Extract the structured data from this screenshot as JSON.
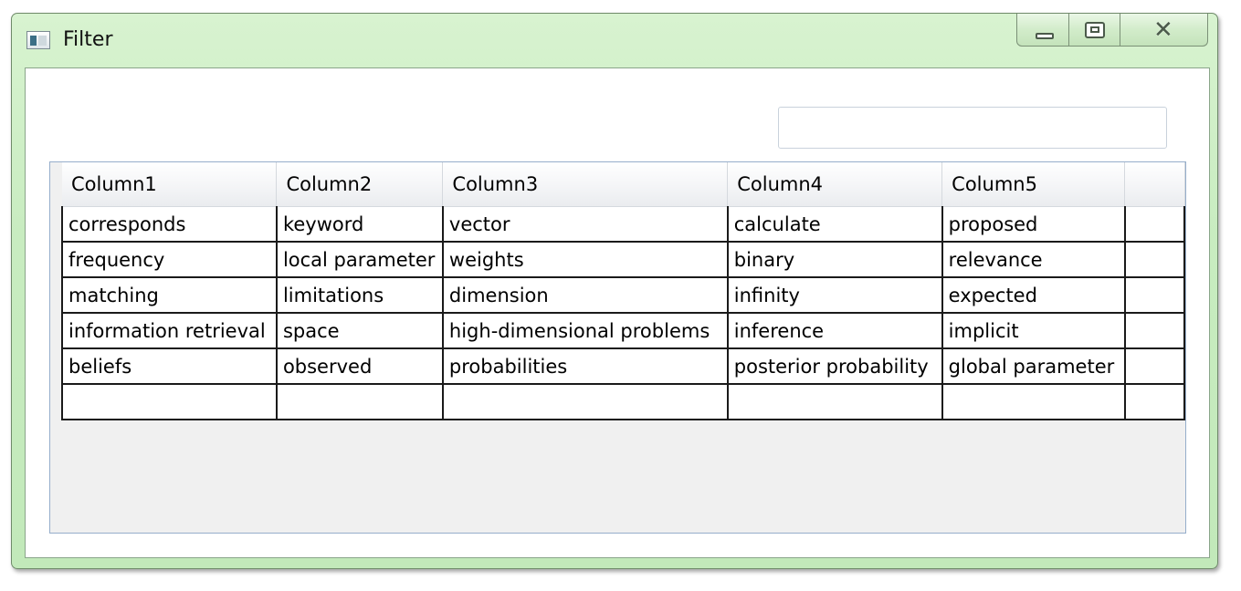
{
  "window": {
    "title": "Filter"
  },
  "icons": {
    "app": "window-app-icon",
    "minimize": "minimize-icon",
    "maximize": "maximize-icon",
    "close": "close-icon"
  },
  "search": {
    "value": "",
    "placeholder": ""
  },
  "grid": {
    "columns": [
      "Column1",
      "Column2",
      "Column3",
      "Column4",
      "Column5"
    ],
    "rows": [
      [
        "corresponds",
        "keyword",
        "vector",
        "calculate",
        "proposed"
      ],
      [
        "frequency",
        "local parameter",
        "weights",
        "binary",
        "relevance"
      ],
      [
        "matching",
        "limitations",
        "dimension",
        "infinity",
        "expected"
      ],
      [
        "information retrieval",
        "space",
        "high-dimensional problems",
        "inference",
        "implicit"
      ],
      [
        "beliefs",
        "observed",
        "probabilities",
        "posterior probability",
        "global parameter"
      ],
      [
        "",
        "",
        "",
        "",
        ""
      ]
    ]
  }
}
